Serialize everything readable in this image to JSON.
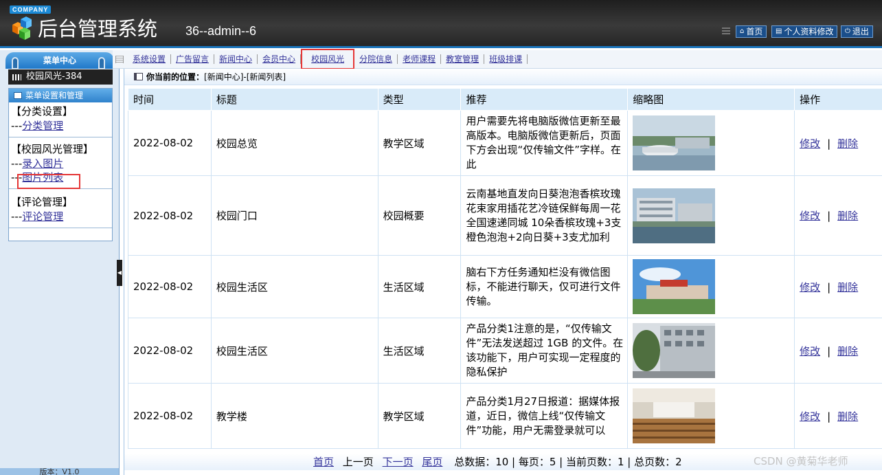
{
  "header": {
    "company": "COMPANY",
    "title": "后台管理系统",
    "user": "36--admin--6",
    "buttons": {
      "home": "首页",
      "profile": "个人资料修改",
      "logout": "退出"
    }
  },
  "sidebar": {
    "menu_center": "菜单中心",
    "current": "校园风光-384",
    "panel_title": "菜单设置和管理",
    "groups": [
      {
        "title": "【分类设置】",
        "items": [
          "分类管理"
        ]
      },
      {
        "title": "【校园风光管理】",
        "items": [
          "录入图片",
          "图片列表"
        ]
      },
      {
        "title": "【评论管理】",
        "items": [
          "评论管理"
        ]
      }
    ],
    "item_prefix": "---",
    "footer": "版本：V1.0"
  },
  "topnav": [
    "系统设置",
    "广告留言",
    "新闻中心",
    "会员中心",
    "校园风光",
    "分院信息",
    "老师课程",
    "教室管理",
    "班级排课"
  ],
  "topnav_active": 4,
  "location": {
    "label": "你当前的位置：",
    "path": "[新闻中心]-[新闻列表]"
  },
  "table": {
    "headers": [
      "时间",
      "标题",
      "类型",
      "推荐",
      "缩略图",
      "操作"
    ],
    "edit_label": "修改",
    "delete_label": "删除",
    "separator": "|",
    "rows": [
      {
        "time": "2022-08-02",
        "title": "校园总览",
        "type": "教学区域",
        "rec": "用户需要先将电脑版微信更新至最高版本。电脑版微信更新后，页面下方会出现“仅传输文件”字样。在此"
      },
      {
        "time": "2022-08-02",
        "title": "校园门口",
        "type": "校园概要",
        "rec": "云南基地直发向日葵泡泡香槟玫瑰花束家用插花艺冷链保鲜每周一花全国速递同城 10朵香槟玫瑰+3支橙色泡泡+2向日葵+3支尤加利"
      },
      {
        "time": "2022-08-02",
        "title": "校园生活区",
        "type": "生活区域",
        "rec": "脑右下方任务通知栏没有微信图标，不能进行聊天，仅可进行文件传输。"
      },
      {
        "time": "2022-08-02",
        "title": "校园生活区",
        "type": "生活区域",
        "rec": "产品分类1注意的是，“仅传输文件”无法发送超过 1GB 的文件。在该功能下，用户可实现一定程度的隐私保护"
      },
      {
        "time": "2022-08-02",
        "title": "教学楼",
        "type": "教学区域",
        "rec": "产品分类1月27日报道：据媒体报道，近日，微信上线“仅传输文件”功能，用户无需登录就可以"
      }
    ]
  },
  "pager": {
    "first": "首页",
    "prev": "上一页",
    "next": "下一页",
    "last": "尾页",
    "stats": "总数据：10 | 每页：5 | 当前页数：1 | 总页数：2"
  },
  "watermark": "CSDN @黄菊华老师",
  "colors": {
    "header_bg": "#2b2b2b",
    "accent": "#1c75bc",
    "highlight": "#e53535",
    "link": "#33339a"
  }
}
